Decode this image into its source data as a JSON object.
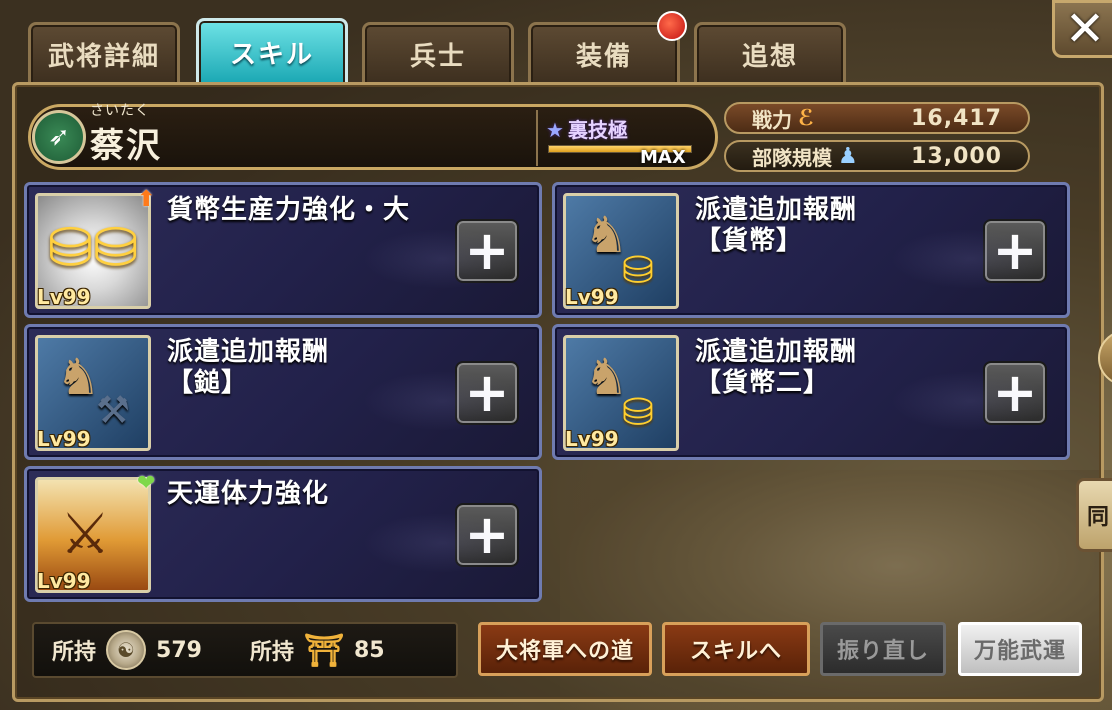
{
  "tabs": [
    {
      "label": "武将詳細",
      "active": false,
      "badge": false
    },
    {
      "label": "スキル",
      "active": true,
      "badge": false
    },
    {
      "label": "兵士",
      "active": false,
      "badge": false
    },
    {
      "label": "装備",
      "active": false,
      "badge": true
    },
    {
      "label": "追想",
      "active": false,
      "badge": false
    }
  ],
  "close_label": "✕",
  "general": {
    "name_ruby": "さいたく",
    "name": "蔡沢",
    "class_icon": "bow-class-icon",
    "rank": {
      "label": "裏技極",
      "max_label": "MAX",
      "progress": 1.0
    }
  },
  "stats": {
    "power_label": "戦力",
    "power_value": "16,417",
    "unit_label": "部隊規模",
    "unit_value": "13,000"
  },
  "skills": [
    {
      "name": "貨幣生産力強化・大",
      "level": "Lv99",
      "icon": "gold-coins-icon",
      "badge": "up-arrow"
    },
    {
      "name": "派遣追加報酬\n【貨幣】",
      "level": "Lv99",
      "icon": "horse-coins-icon",
      "badge": ""
    },
    {
      "name": "派遣追加報酬\n【鎚】",
      "level": "Lv99",
      "icon": "horse-hammer-icon",
      "badge": ""
    },
    {
      "name": "派遣追加報酬\n【貨幣二】",
      "level": "Lv99",
      "icon": "horse-coins-icon",
      "badge": ""
    },
    {
      "name": "天運体力強化",
      "level": "Lv99",
      "icon": "warrior-icon",
      "badge": "heart"
    }
  ],
  "holdings": [
    {
      "label": "所持",
      "value": "579",
      "icon": "medal-coin-icon"
    },
    {
      "label": "所持",
      "value": "85",
      "icon": "gold-seal-icon"
    }
  ],
  "buttons": {
    "road": "大将軍への道",
    "to_skill": "スキルへ",
    "reroll": "振り直し",
    "universal": "万能武運"
  },
  "side_tab_label": "同"
}
